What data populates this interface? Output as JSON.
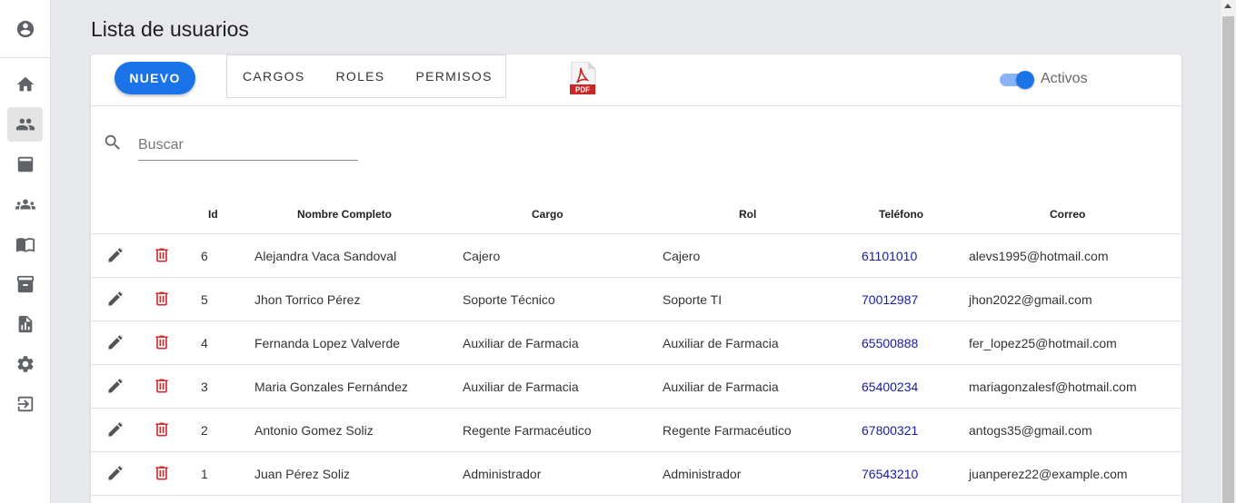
{
  "page": {
    "title": "Lista de usuarios"
  },
  "sidebar": {
    "items": [
      {
        "name": "account",
        "icon": "account-circle-icon"
      },
      {
        "name": "home",
        "icon": "home-icon"
      },
      {
        "name": "users",
        "icon": "people-icon",
        "active": true
      },
      {
        "name": "inventory",
        "icon": "inbox-icon"
      },
      {
        "name": "groups",
        "icon": "groups-icon"
      },
      {
        "name": "catalog",
        "icon": "menu-book-icon"
      },
      {
        "name": "archive",
        "icon": "archive-icon"
      },
      {
        "name": "reports",
        "icon": "report-icon"
      },
      {
        "name": "settings",
        "icon": "gear-icon"
      },
      {
        "name": "logout",
        "icon": "logout-icon"
      }
    ]
  },
  "toolbar": {
    "new_label": "NUEVO",
    "group_buttons": [
      "CARGOS",
      "ROLES",
      "PERMISOS"
    ],
    "pdf_label": "PDF",
    "toggle_label": "Activos",
    "toggle_on": true
  },
  "search": {
    "placeholder": "Buscar",
    "value": ""
  },
  "table": {
    "headers": {
      "id": "Id",
      "name": "Nombre Completo",
      "cargo": "Cargo",
      "rol": "Rol",
      "telefono": "Teléfono",
      "correo": "Correo"
    },
    "rows": [
      {
        "id": "6",
        "name": "Alejandra Vaca Sandoval",
        "cargo": "Cajero",
        "rol": "Cajero",
        "telefono": "61101010",
        "correo": "alevs1995@hotmail.com"
      },
      {
        "id": "5",
        "name": "Jhon Torrico Pérez",
        "cargo": "Soporte Técnico",
        "rol": "Soporte TI",
        "telefono": "70012987",
        "correo": "jhon2022@gmail.com"
      },
      {
        "id": "4",
        "name": "Fernanda Lopez Valverde",
        "cargo": "Auxiliar de Farmacia",
        "rol": "Auxiliar de Farmacia",
        "telefono": "65500888",
        "correo": "fer_lopez25@hotmail.com"
      },
      {
        "id": "3",
        "name": "Maria Gonzales Fernández",
        "cargo": "Auxiliar de Farmacia",
        "rol": "Auxiliar de Farmacia",
        "telefono": "65400234",
        "correo": "mariagonzalesf@hotmail.com"
      },
      {
        "id": "2",
        "name": "Antonio Gomez Soliz",
        "cargo": "Regente Farmacéutico",
        "rol": "Regente Farmacéutico",
        "telefono": "67800321",
        "correo": "antogs35@gmail.com"
      },
      {
        "id": "1",
        "name": "Juan Pérez Soliz",
        "cargo": "Administrador",
        "rol": "Administrador",
        "telefono": "76543210",
        "correo": "juanperez22@example.com"
      }
    ]
  },
  "colors": {
    "primary": "#1a73e8",
    "danger": "#d32f2f",
    "phone": "#1a1aa8",
    "background": "#e6e8ec"
  }
}
